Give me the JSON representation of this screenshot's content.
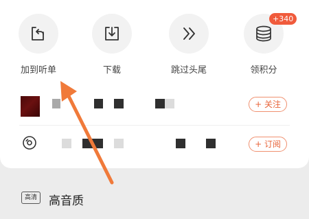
{
  "actions": [
    {
      "label": "加到听单",
      "icon": "add-to-playlist-icon"
    },
    {
      "label": "下载",
      "icon": "download-icon"
    },
    {
      "label": "跳过头尾",
      "icon": "skip-forward-icon"
    },
    {
      "label": "领积分",
      "icon": "coins-stack-icon"
    }
  ],
  "points_badge": "+340",
  "rows": [
    {
      "button": "+ 关注"
    },
    {
      "button": "+ 订阅"
    }
  ],
  "quality": {
    "tag": "高清",
    "label": "高音质"
  },
  "colors": {
    "accent": "#e8643a",
    "annotation_arrow": "#f07a3a"
  }
}
